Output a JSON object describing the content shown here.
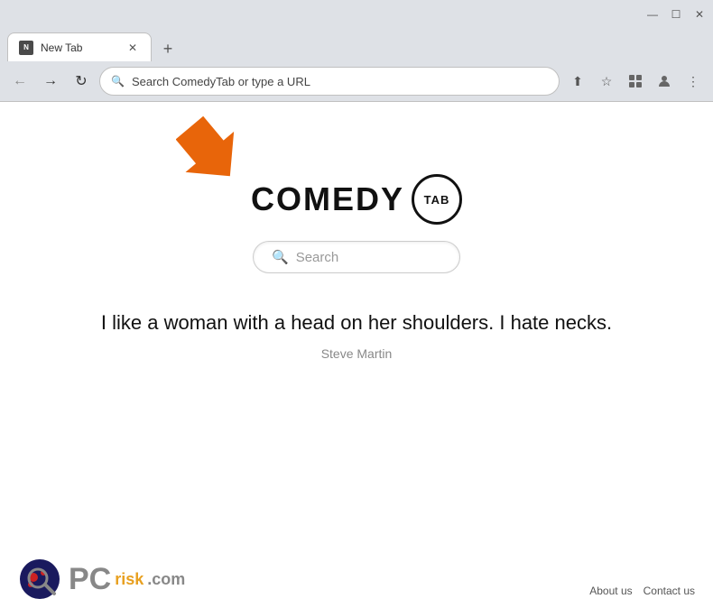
{
  "browser": {
    "tab_label": "New Tab",
    "new_tab_button": "+",
    "address_bar_text": "Search ComedyTab or type a URL",
    "nav_back": "←",
    "nav_forward": "→",
    "nav_refresh": "↻"
  },
  "page": {
    "logo_comedy": "COMEDY",
    "logo_tab": "TAB",
    "search_placeholder": "Search",
    "quote_text": "I like a woman with a head on her shoulders. I hate necks.",
    "quote_author": "Steve Martin"
  },
  "footer": {
    "about_us": "About us",
    "contact_us": "Contact us",
    "pcrisk": "PC",
    "risk": "risk",
    "com": ".com"
  },
  "toolbar_actions": {
    "share": "⬆",
    "star": "☆",
    "extensions": "🧩",
    "profile": "👤",
    "menu": "⋮"
  }
}
